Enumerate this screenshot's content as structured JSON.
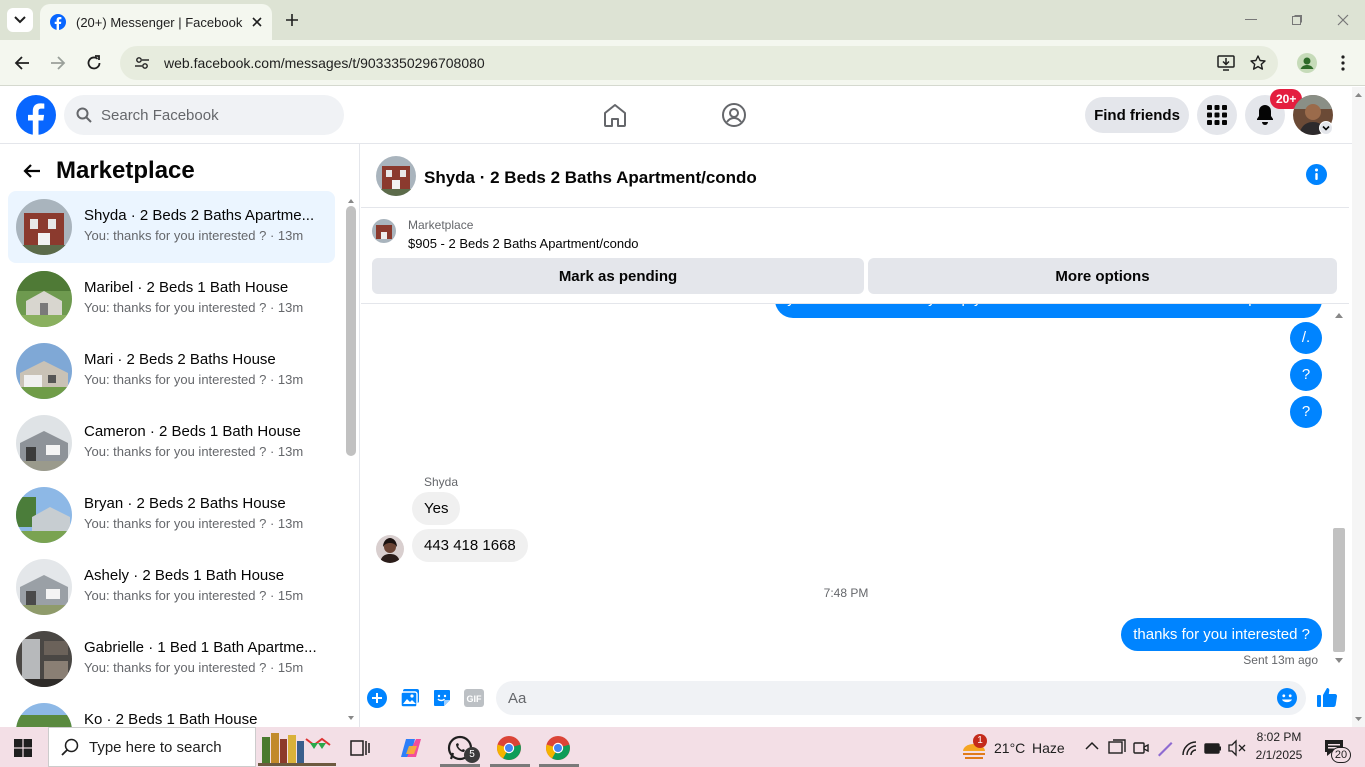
{
  "browser": {
    "tab_title": "(20+) Messenger | Facebook",
    "url": "web.facebook.com/messages/t/9033350296708080"
  },
  "fb": {
    "search_placeholder": "Search Facebook",
    "find_friends": "Find friends",
    "notif_count": "20+"
  },
  "sidebar": {
    "title": "Marketplace",
    "conversations": [
      {
        "title": "Shyda · 2 Beds 2 Baths Apartme...",
        "sub": "You: thanks for you interested ? · 13m",
        "active": true
      },
      {
        "title": "Maribel · 2 Beds 1 Bath House",
        "sub": "You: thanks for you interested ? · 13m"
      },
      {
        "title": "Mari · 2 Beds 2 Baths House",
        "sub": "You: thanks for you interested ? · 13m"
      },
      {
        "title": "Cameron · 2 Beds 1 Bath House",
        "sub": "You: thanks for you interested ? · 13m"
      },
      {
        "title": "Bryan · 2 Beds 2 Baths House",
        "sub": "You: thanks for you interested ? · 13m"
      },
      {
        "title": "Ashely · 2 Beds 1 Bath House",
        "sub": "You: thanks for you interested ? · 15m"
      },
      {
        "title": "Gabrielle · 1 Bed 1 Bath Apartme...",
        "sub": "You: thanks for you interested ? · 15m"
      },
      {
        "title": "Ko · 2 Beds 1 Bath House",
        "sub": ""
      }
    ]
  },
  "chat": {
    "title": "Shyda · 2 Beds 2 Baths Apartment/condo",
    "listing_category": "Marketplace",
    "listing_desc": "$905 - 2 Beds 2 Baths Apartment/condo",
    "mark_pending": "Mark as pending",
    "more_options": "More options",
    "cut_message": "yes its available kindly drop your number for more information and requirement",
    "out_messages": [
      "/.",
      "?",
      "?"
    ],
    "sender_name": "Shyda",
    "in_messages": [
      "Yes",
      "443 418 1668"
    ],
    "timestamp": "7:48 PM",
    "last_message": "thanks for you interested ?",
    "sent_status": "Sent 13m ago",
    "composer_placeholder": "Aa"
  },
  "taskbar": {
    "search_placeholder": "Type here to search",
    "whatsapp_badge": "5",
    "weather_badge": "1",
    "temperature": "21°C",
    "weather": "Haze",
    "time": "8:02 PM",
    "date": "2/1/2025",
    "notif_count": "20"
  },
  "colors": {
    "fb_blue": "#0866ff",
    "messenger_blue": "#0084ff",
    "badge_red": "#e41e3f"
  }
}
